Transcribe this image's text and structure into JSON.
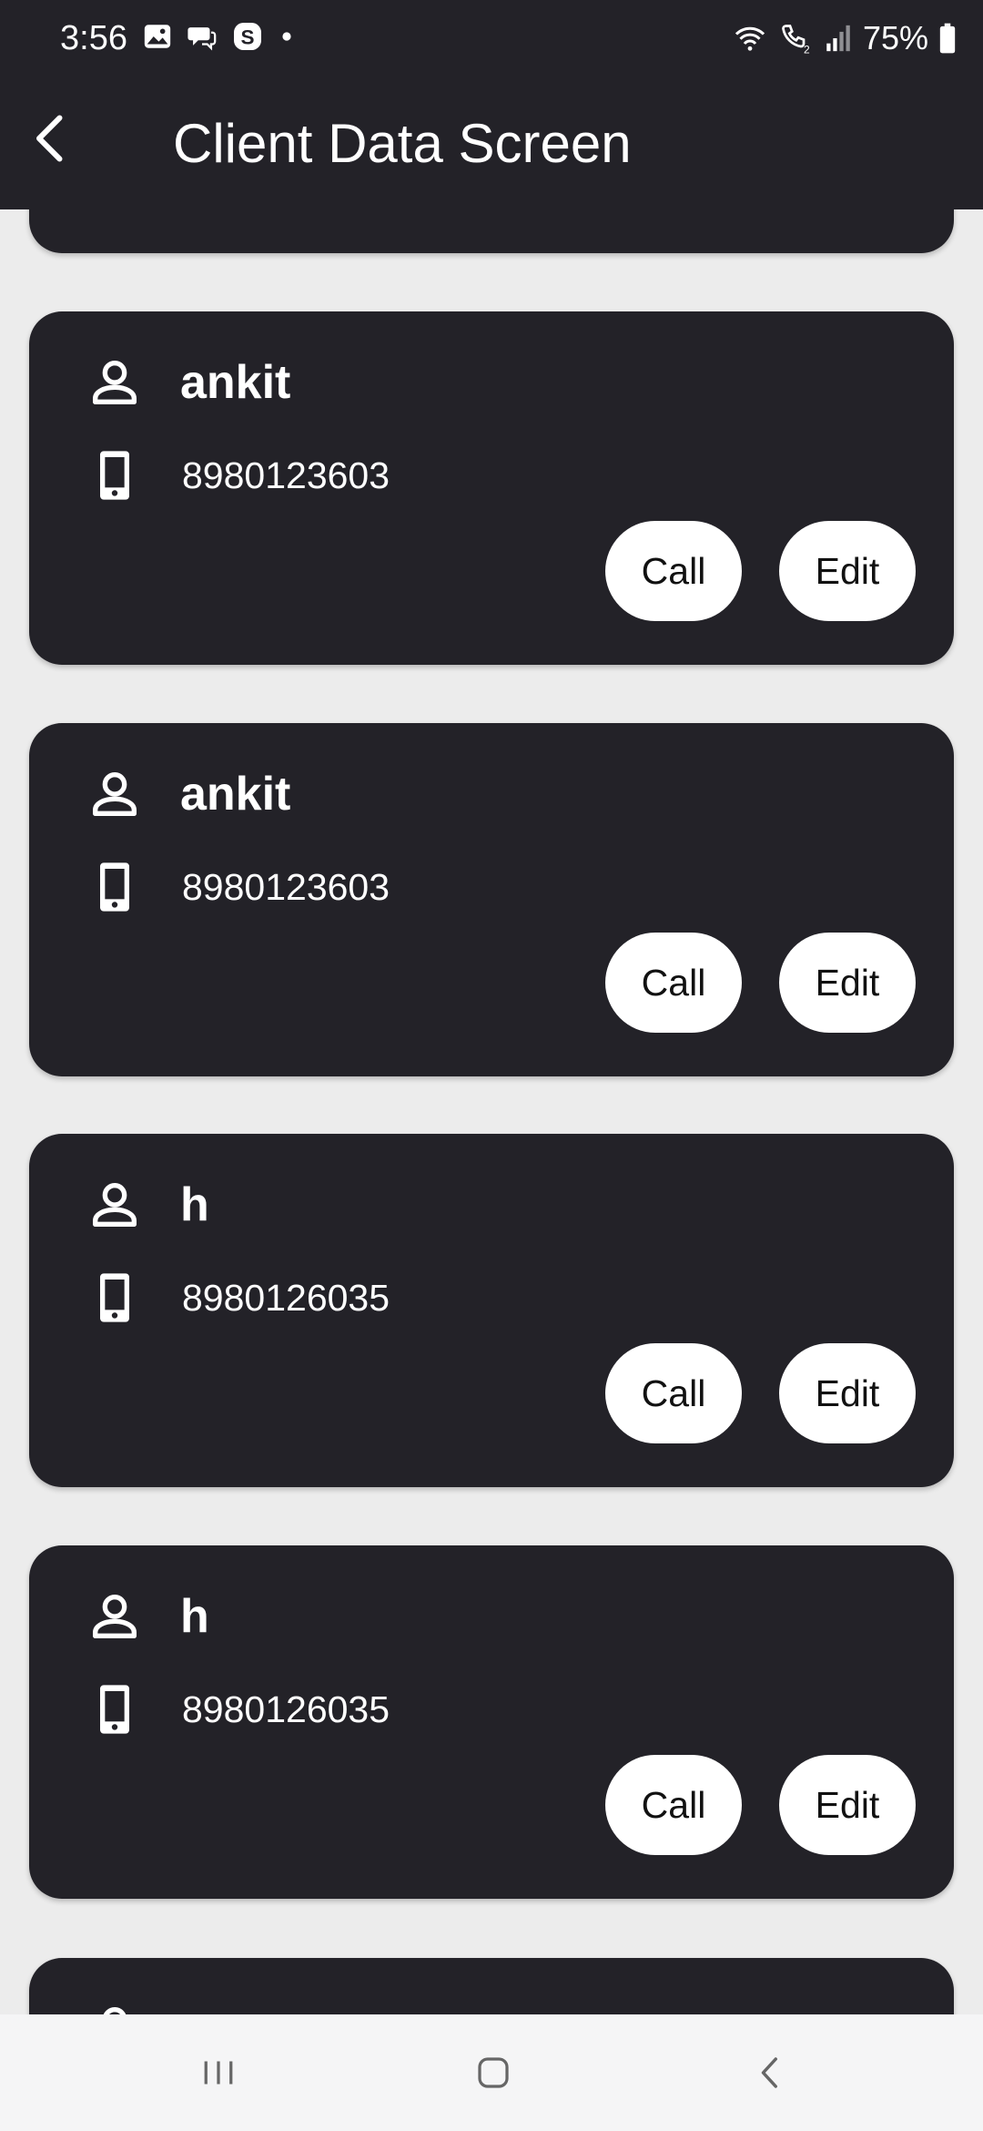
{
  "status_bar": {
    "time": "3:56",
    "battery": "75%",
    "left_icons": [
      "gallery-icon",
      "chat-icon",
      "skype-icon",
      "dot-icon"
    ],
    "right_icons": [
      "wifi-icon",
      "wifi-calling-icon",
      "signal-icon",
      "battery-icon"
    ]
  },
  "app_bar": {
    "title": "Client Data Screen",
    "back_icon": "back-arrow-icon"
  },
  "clients": [
    {
      "name": "ankit",
      "phone": "8980123603",
      "call_label": "Call",
      "edit_label": "Edit"
    },
    {
      "name": "ankit",
      "phone": "8980123603",
      "call_label": "Call",
      "edit_label": "Edit"
    },
    {
      "name": "h",
      "phone": "8980126035",
      "call_label": "Call",
      "edit_label": "Edit"
    },
    {
      "name": "h",
      "phone": "8980126035",
      "call_label": "Call",
      "edit_label": "Edit"
    }
  ],
  "nav_bar": {
    "items": [
      "recent-apps-icon",
      "home-icon",
      "back-icon"
    ]
  },
  "colors": {
    "surface_dark": "#232228",
    "background": "#ececec",
    "button_bg": "#ffffff",
    "text_light": "#ffffff"
  }
}
